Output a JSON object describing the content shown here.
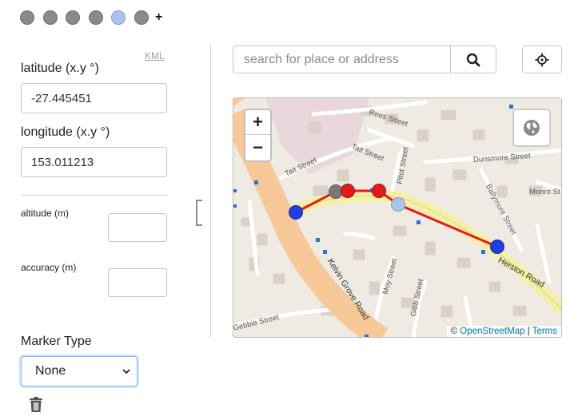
{
  "markers": {
    "dots": [
      "marker-1",
      "marker-2",
      "marker-3",
      "marker-4",
      "marker-5",
      "marker-6"
    ],
    "active_index": 4,
    "add_label": "+"
  },
  "kml_link": "KML",
  "latitude": {
    "label": "latitude (x.y °)",
    "value": "-27.445451"
  },
  "longitude": {
    "label": "longitude (x.y °)",
    "value": "153.011213"
  },
  "altitude": {
    "label": "altitude (m)",
    "value": ""
  },
  "accuracy": {
    "label": "accuracy (m)",
    "value": ""
  },
  "marker_type": {
    "label": "Marker Type",
    "selected": "None"
  },
  "search": {
    "placeholder": "search for place or address"
  },
  "map": {
    "zoom_in": "+",
    "zoom_out": "−",
    "attribution_prefix": "©",
    "attribution_link": "OpenStreetMap",
    "attribution_sep": "|",
    "terms_link": "Terms",
    "streets": {
      "rees": "Rees Street",
      "tait1": "Tait Street",
      "tait2": "Tait Street",
      "pitot": "Pitot Street",
      "dunsmore": "Dunsmore Street",
      "ballymore": "Ballymore Street",
      "monro": "Monro St",
      "herston": "Herston Road",
      "kelvin": "Kelvin Grove Road",
      "moy": "Moy Street",
      "gibb": "Gibb Street",
      "gebbie": "Gebbie Street"
    }
  },
  "colors": {
    "route": "#e31a1c",
    "marker_blue": "#1f3fe0",
    "marker_red": "#e31a1c",
    "marker_grey": "#7a7a7a",
    "marker_light": "#a9c4ec",
    "main_road": "#f7c898"
  }
}
